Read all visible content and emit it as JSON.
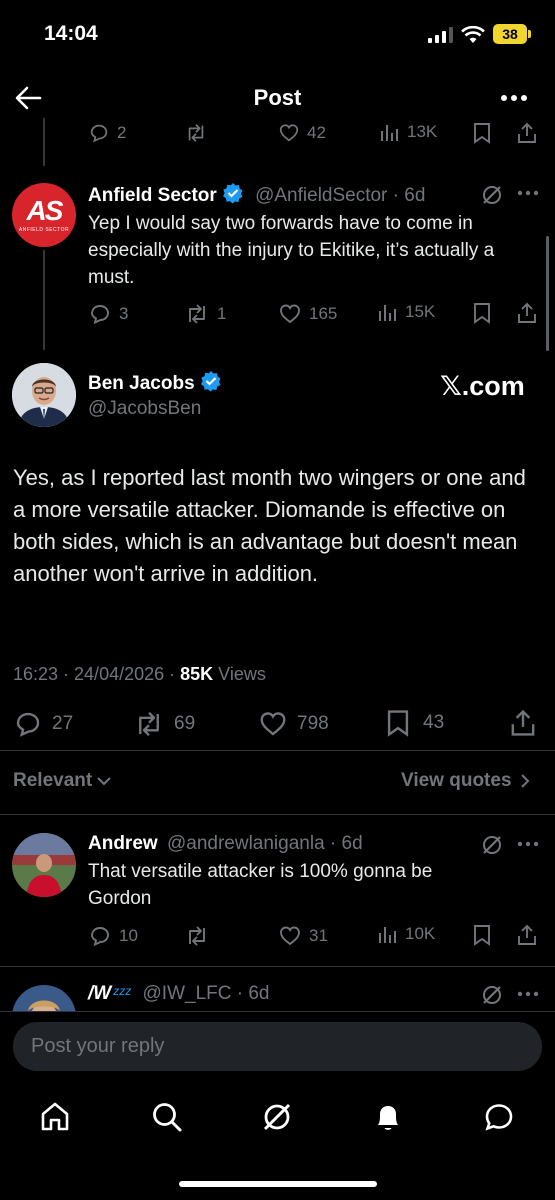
{
  "status_bar": {
    "time": "14:04",
    "battery": "38"
  },
  "header": {
    "title": "Post"
  },
  "prev_actions": {
    "replies": "2",
    "retweets": "",
    "likes": "42",
    "views": "13K"
  },
  "reply1": {
    "name": "Anfield Sector",
    "handle": "@AnfieldSector",
    "time": "6d",
    "logo_text": "AS",
    "logo_subtext": "ANFIELD SECTOR",
    "text": "Yep I would say two forwards have to come in especially with the injury to Ekitike, it’s actually a must.",
    "replies": "3",
    "retweets": "1",
    "likes": "165",
    "views": "15K"
  },
  "main": {
    "name": "Ben Jacobs",
    "handle": "@JacobsBen",
    "watermark": "𝕏.com",
    "text": "Yes, as I reported last month two wingers or one and a more versatile attacker. Diomande is effective on both sides, which is an advantage but doesn't mean another won't arrive in addition.",
    "timestamp": "16:23 · 24/04/2026 · ",
    "views_count": "85K",
    "views_label": " Views",
    "replies": "27",
    "retweets": "69",
    "likes": "798",
    "bookmarks": "43"
  },
  "filters": {
    "sort": "Relevant",
    "quotes": "View quotes"
  },
  "reply2": {
    "name": "Andrew",
    "handle": "@andrewlaniganla",
    "time": "6d",
    "text": "That versatile attacker is 100% gonna be Gordon",
    "replies": "10",
    "retweets": "",
    "likes": "31",
    "views": "10K"
  },
  "reply3": {
    "name": "/W",
    "name_suffix": "zzz",
    "handle": "@IW_LFC",
    "time": "6d"
  },
  "composer": {
    "placeholder": "Post your reply"
  },
  "colors": {
    "accent": "#1d9bf0",
    "muted": "#71767b",
    "logo_red": "#d8242b"
  }
}
